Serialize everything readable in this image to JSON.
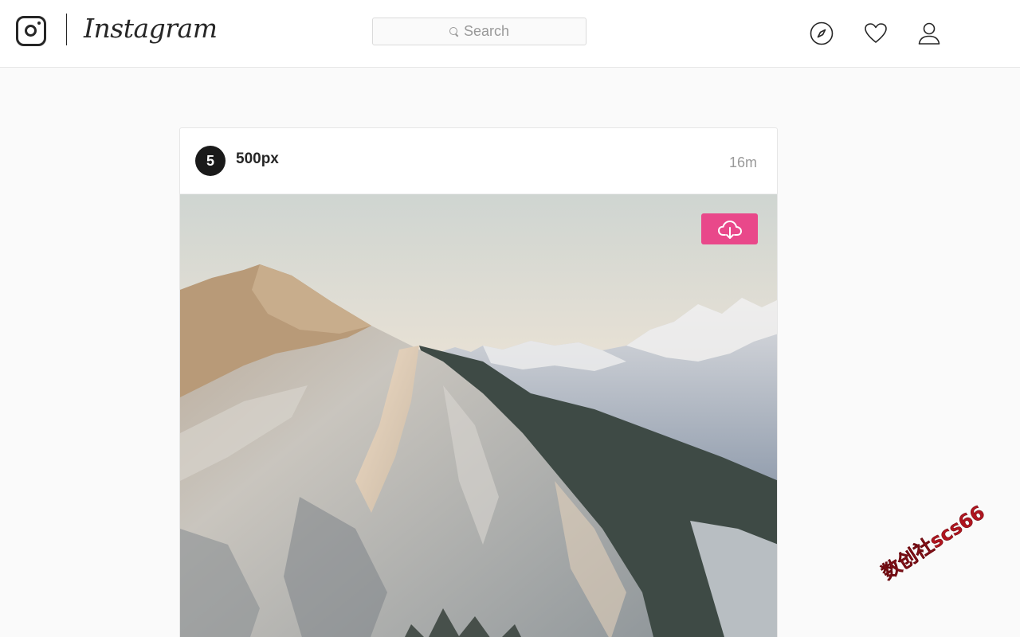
{
  "app": {
    "wordmark": "Instagram"
  },
  "header": {
    "search_placeholder": "Search",
    "icons": [
      "explore-compass-icon",
      "activity-heart-icon",
      "profile-user-icon"
    ]
  },
  "post": {
    "username": "500px",
    "avatar_glyph": "5",
    "time": "16m",
    "download_button_color": "#e9488a",
    "photo_subject": "mountain"
  },
  "watermark": {
    "text": "数创社scs66"
  },
  "colors": {
    "accent": "#e9488a",
    "text": "#262626",
    "muted": "#999999",
    "border": "#dbdbdb",
    "background": "#fafafa"
  }
}
